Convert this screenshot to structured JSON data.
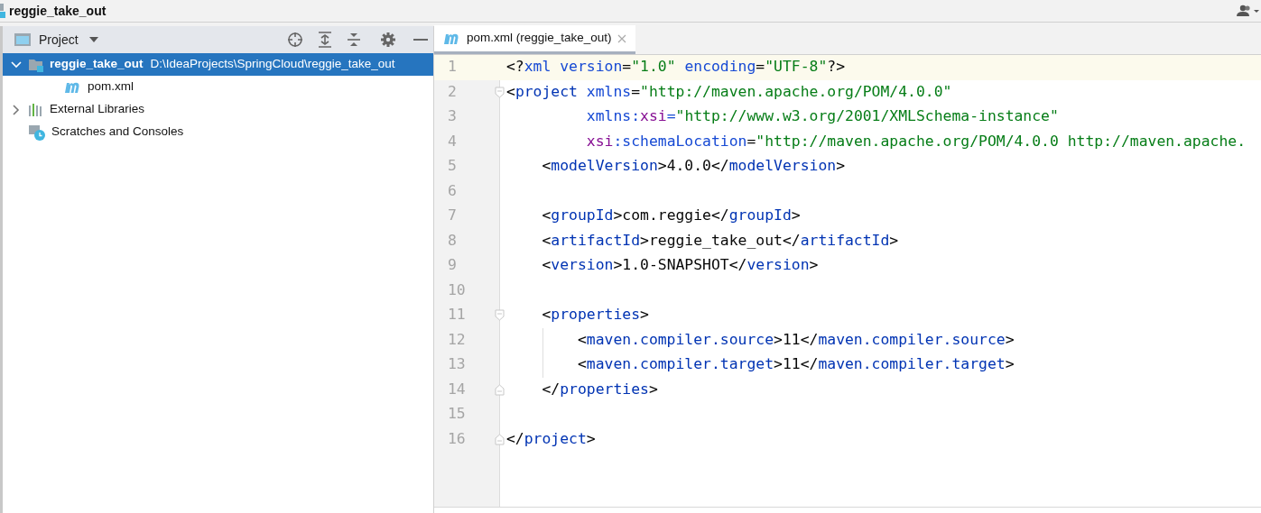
{
  "window": {
    "title": "reggie_take_out"
  },
  "project_panel": {
    "title": "Project",
    "tree": [
      {
        "label": "reggie_take_out",
        "path": "D:\\IdeaProjects\\SpringCloud\\reggie_take_out",
        "kind": "module",
        "selected": true,
        "expanded": true,
        "children": [
          {
            "label": "pom.xml",
            "kind": "maven",
            "selected": false
          }
        ]
      },
      {
        "label": "External Libraries",
        "kind": "libraries",
        "selected": false,
        "expanded": false
      },
      {
        "label": "Scratches and Consoles",
        "kind": "scratches",
        "selected": false
      }
    ]
  },
  "editor": {
    "tabs": [
      {
        "label": "pom.xml (reggie_take_out)",
        "selected": true
      }
    ],
    "lines": [
      {
        "number": "1",
        "current": true,
        "tokens": [
          {
            "kind": "plain",
            "text": "<?"
          },
          {
            "kind": "attr",
            "text": "xml version"
          },
          {
            "kind": "plain",
            "text": "="
          },
          {
            "kind": "value",
            "text": "\"1.0\""
          },
          {
            "kind": "attr",
            "text": " encoding"
          },
          {
            "kind": "plain",
            "text": "="
          },
          {
            "kind": "value",
            "text": "\"UTF-8\""
          },
          {
            "kind": "plain",
            "text": "?>"
          }
        ]
      },
      {
        "number": "2",
        "fold_open": true,
        "tokens": [
          {
            "kind": "plain",
            "text": "<"
          },
          {
            "kind": "tag",
            "text": "project"
          },
          {
            "kind": "attr",
            "text": " xmlns"
          },
          {
            "kind": "plain",
            "text": "="
          },
          {
            "kind": "value",
            "text": "\"http://maven.apache.org/POM/4.0.0\""
          }
        ]
      },
      {
        "number": "3",
        "tokens": [
          {
            "kind": "attr",
            "text": "         xmlns:"
          },
          {
            "kind": "ns",
            "text": "xsi"
          },
          {
            "kind": "attr",
            "text": "="
          },
          {
            "kind": "value",
            "text": "\"http://www.w3.org/2001/XMLSchema-instance\""
          }
        ]
      },
      {
        "number": "4",
        "tokens": [
          {
            "kind": "ns",
            "text": "         xsi"
          },
          {
            "kind": "attr",
            "text": ":schemaLocation"
          },
          {
            "kind": "plain",
            "text": "="
          },
          {
            "kind": "value",
            "text": "\"http://maven.apache.org/POM/4.0.0 http://maven.apache."
          }
        ]
      },
      {
        "number": "5",
        "tokens": [
          {
            "kind": "plain",
            "text": "    <"
          },
          {
            "kind": "tag",
            "text": "modelVersion"
          },
          {
            "kind": "plain",
            "text": ">4.0.0</"
          },
          {
            "kind": "tag",
            "text": "modelVersion"
          },
          {
            "kind": "plain",
            "text": ">"
          }
        ]
      },
      {
        "number": "6"
      },
      {
        "number": "7",
        "tokens": [
          {
            "kind": "plain",
            "text": "    <"
          },
          {
            "kind": "tag",
            "text": "groupId"
          },
          {
            "kind": "plain",
            "text": ">com.reggie</"
          },
          {
            "kind": "tag",
            "text": "groupId"
          },
          {
            "kind": "plain",
            "text": ">"
          }
        ]
      },
      {
        "number": "8",
        "tokens": [
          {
            "kind": "plain",
            "text": "    <"
          },
          {
            "kind": "tag",
            "text": "artifactId"
          },
          {
            "kind": "plain",
            "text": ">reggie_take_out</"
          },
          {
            "kind": "tag",
            "text": "artifactId"
          },
          {
            "kind": "plain",
            "text": ">"
          }
        ]
      },
      {
        "number": "9",
        "tokens": [
          {
            "kind": "plain",
            "text": "    <"
          },
          {
            "kind": "tag",
            "text": "version"
          },
          {
            "kind": "plain",
            "text": ">1.0-SNAPSHOT</"
          },
          {
            "kind": "tag",
            "text": "version"
          },
          {
            "kind": "plain",
            "text": ">"
          }
        ]
      },
      {
        "number": "10"
      },
      {
        "number": "11",
        "fold_open": true,
        "tokens": [
          {
            "kind": "plain",
            "text": "    <"
          },
          {
            "kind": "tag",
            "text": "properties"
          },
          {
            "kind": "plain",
            "text": ">"
          }
        ]
      },
      {
        "number": "12",
        "guide": true,
        "tokens": [
          {
            "kind": "plain",
            "text": "        <"
          },
          {
            "kind": "tag",
            "text": "maven.compiler.source"
          },
          {
            "kind": "plain",
            "text": ">11</"
          },
          {
            "kind": "tag",
            "text": "maven.compiler.source"
          },
          {
            "kind": "plain",
            "text": ">"
          }
        ]
      },
      {
        "number": "13",
        "guide": true,
        "tokens": [
          {
            "kind": "plain",
            "text": "        <"
          },
          {
            "kind": "tag",
            "text": "maven.compiler.target"
          },
          {
            "kind": "plain",
            "text": ">11</"
          },
          {
            "kind": "tag",
            "text": "maven.compiler.target"
          },
          {
            "kind": "plain",
            "text": ">"
          }
        ]
      },
      {
        "number": "14",
        "fold_close": true,
        "tokens": [
          {
            "kind": "plain",
            "text": "    </"
          },
          {
            "kind": "tag",
            "text": "properties"
          },
          {
            "kind": "plain",
            "text": ">"
          }
        ]
      },
      {
        "number": "15"
      },
      {
        "number": "16",
        "fold_close": true,
        "tokens": [
          {
            "kind": "plain",
            "text": "</"
          },
          {
            "kind": "tag",
            "text": "project"
          },
          {
            "kind": "plain",
            "text": ">"
          }
        ]
      }
    ]
  }
}
